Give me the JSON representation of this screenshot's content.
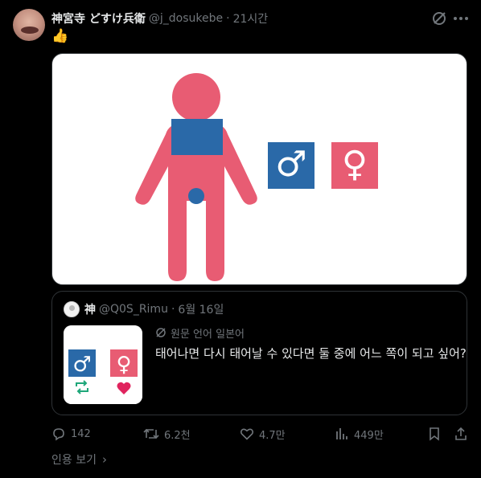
{
  "tweet": {
    "author_name": "神宮寺 どすけ兵衛",
    "author_handle": "@j_dosukebe",
    "separator": "·",
    "time": "21시간",
    "text_emoji": "👍",
    "more_icon": "more-horizontal-icon"
  },
  "quoted": {
    "author_name": "神",
    "author_handle": "@Q0S_Rimu",
    "separator": "·",
    "time": "6월 16일",
    "translation_note": "원문 언어 일본어",
    "text": "태어나면 다시 태어날 수 있다면 둘 중에 어느 쪽이 되고 싶어?"
  },
  "image": {
    "male_symbol": "♂",
    "female_symbol": "♀",
    "colors": {
      "body": "#e85c73",
      "band": "#2a69a8",
      "male_box": "#2a69a8",
      "female_box": "#e85c73"
    }
  },
  "actions": {
    "replies": "142",
    "reposts": "6.2천",
    "likes": "4.7만",
    "views": "449만"
  },
  "footer": {
    "quotes_label": "인용 보기",
    "chevron": "›"
  }
}
